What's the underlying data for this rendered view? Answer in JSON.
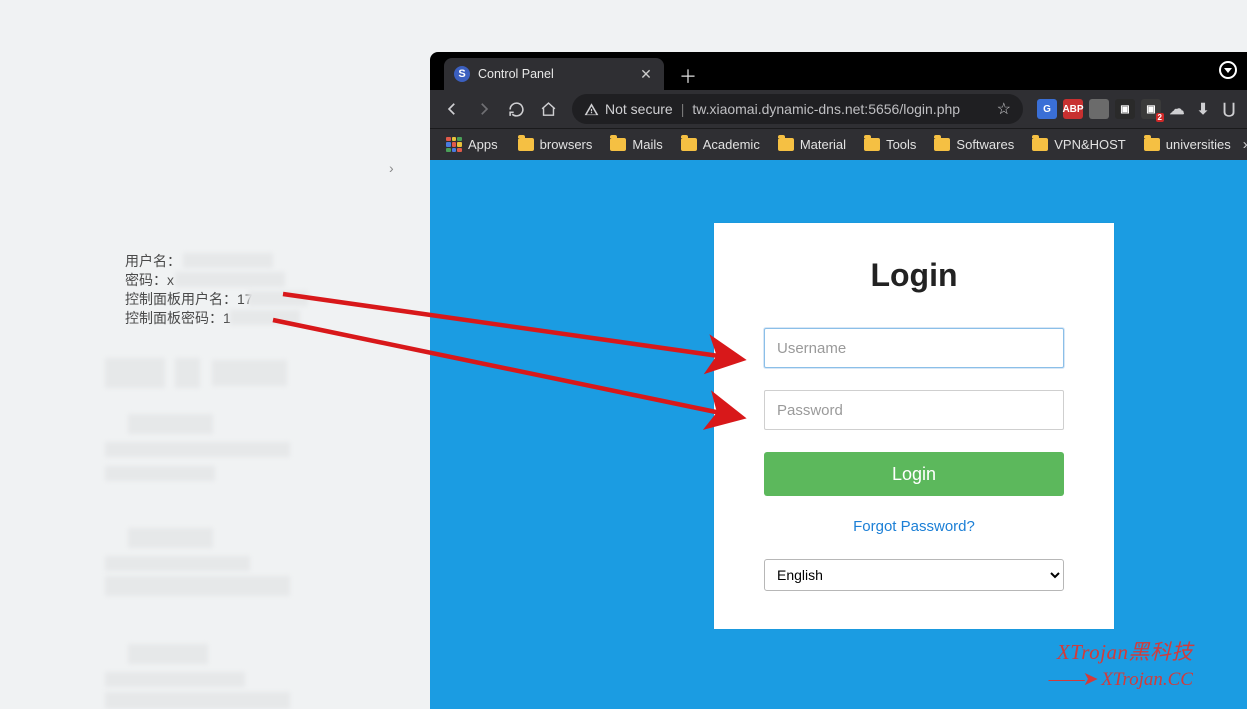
{
  "left_panel": {
    "lines": [
      {
        "label": "用户名：",
        "value": ""
      },
      {
        "label": "密码：",
        "value": "x"
      },
      {
        "label": "控制面板用户名：",
        "value": "17"
      },
      {
        "label": "控制面板密码：",
        "value": "1"
      }
    ]
  },
  "browser": {
    "tab": {
      "title": "Control Panel",
      "favicon_letter": "S"
    },
    "security_label": "Not secure",
    "url": "tw.xiaomai.dynamic-dns.net:5656/login.php",
    "apps_label": "Apps",
    "bookmarks": [
      "browsers",
      "Mails",
      "Academic",
      "Material",
      "Tools",
      "Softwares",
      "VPN&HOST",
      "universities"
    ],
    "extensions": [
      {
        "name": "translate-icon",
        "bg": "#3a6fd6",
        "text": "G"
      },
      {
        "name": "adblock-icon",
        "bg": "#c83030",
        "text": "ABP"
      },
      {
        "name": "ext-1-icon",
        "bg": "#6b6b6b",
        "text": ""
      },
      {
        "name": "ext-2-icon",
        "bg": "#2a2a2a",
        "text": "▣"
      },
      {
        "name": "camera-icon",
        "bg": "#3a3a3a",
        "text": "▣",
        "badge": "2"
      },
      {
        "name": "cloud-icon",
        "bg": "transparent",
        "text": "☁"
      },
      {
        "name": "download-icon",
        "bg": "transparent",
        "text": "⬇"
      },
      {
        "name": "pocket-icon",
        "bg": "transparent",
        "text": "⋃"
      }
    ]
  },
  "login": {
    "heading": "Login",
    "username_placeholder": "Username",
    "password_placeholder": "Password",
    "button": "Login",
    "forgot": "Forgot Password?",
    "language_selected": "English"
  },
  "watermark": {
    "line1": "XTrojan黑科技",
    "line2_arrow": "——➤",
    "line2_text": " XTrojan.CC"
  }
}
